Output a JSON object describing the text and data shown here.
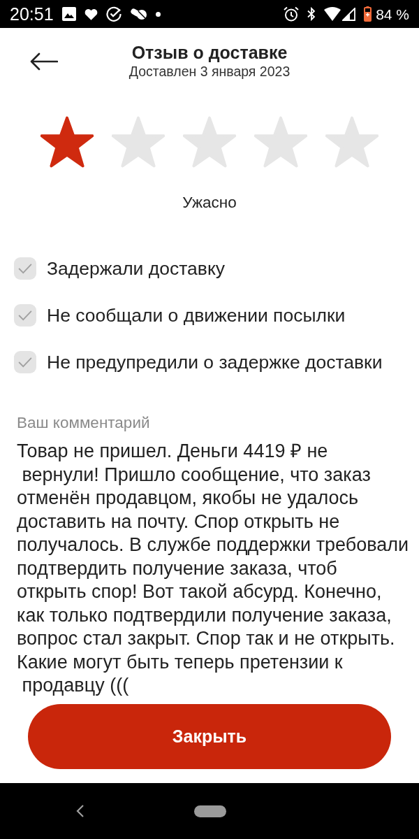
{
  "status_bar": {
    "time": "20:51",
    "battery": "84 %"
  },
  "header": {
    "title": "Отзыв о доставке",
    "subtitle": "Доставлен 3 января 2023"
  },
  "rating": {
    "stars": 1,
    "label": "Ужасно"
  },
  "reasons": [
    {
      "label": "Задержали доставку",
      "checked": true
    },
    {
      "label": "Не сообщали о движении посылки",
      "checked": true
    },
    {
      "label": "Не предупредили о задержке доставки",
      "checked": true
    }
  ],
  "comment": {
    "label": "Ваш комментарий",
    "text": "Товар не пришел. Деньги 4419 ₽ не\n вернули! Пришло сообщение, что заказ отменён продавцом, якобы не удалось доставить на почту. Спор открыть не получалось. В службе поддержки требовали подтвердить получение заказа, чтоб открыть спор! Вот такой абсурд. Конечно, как только подтвердили получение заказа, вопрос стал закрыт. Спор так и не открыть. Какие могут быть теперь претензии к\n продавцу ((("
  },
  "close_button": {
    "label": "Закрыть"
  }
}
